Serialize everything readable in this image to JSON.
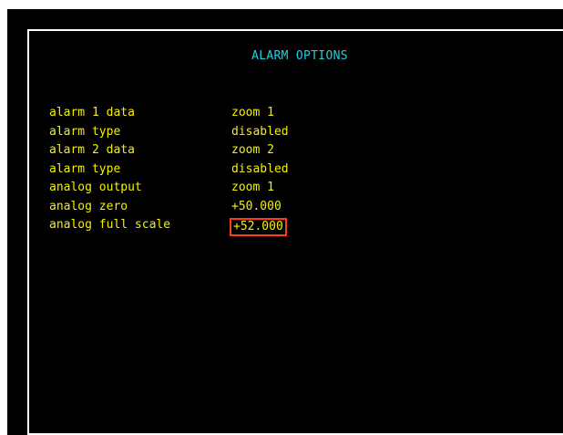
{
  "title": "ALARM OPTIONS",
  "colors": {
    "background": "#000000",
    "title": "#19d3e6",
    "text": "#f5f000",
    "selection_border": "#ff3b1f",
    "frame": "#ffffff"
  },
  "options": [
    {
      "label": "alarm 1 data",
      "value": "zoom 1"
    },
    {
      "label": "alarm type",
      "value": "disabled"
    },
    {
      "label": "alarm 2 data",
      "value": "zoom 2"
    },
    {
      "label": "alarm type",
      "value": "disabled"
    },
    {
      "label": "analog output",
      "value": "zoom 1"
    },
    {
      "label": "analog zero",
      "value": "+50.000"
    },
    {
      "label": "analog full scale",
      "value": "+52.000",
      "selected": true
    }
  ]
}
